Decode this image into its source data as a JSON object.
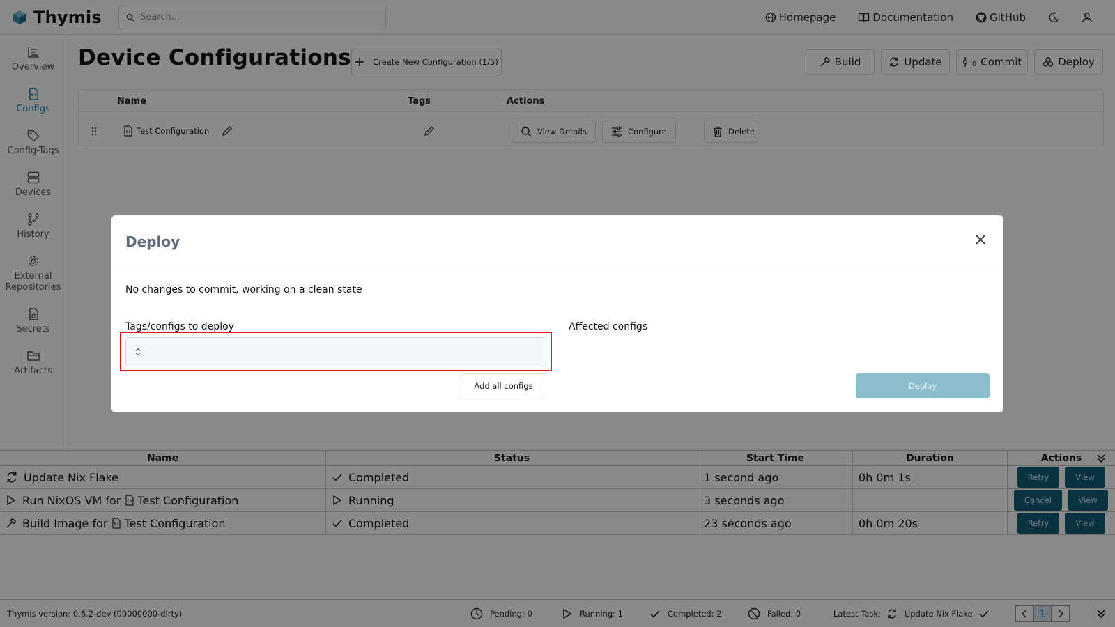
{
  "app": {
    "name": "Thymis"
  },
  "search": {
    "placeholder": "Search..."
  },
  "nav": {
    "homepage": "Homepage",
    "documentation": "Documentation",
    "github": "GitHub"
  },
  "sidebar": {
    "items": [
      {
        "label": "Overview",
        "icon": "chart-icon"
      },
      {
        "label": "Configs",
        "icon": "config-file-icon",
        "active": true
      },
      {
        "label": "Config-Tags",
        "icon": "tag-icon"
      },
      {
        "label": "Devices",
        "icon": "server-icon"
      },
      {
        "label": "History",
        "icon": "git-branch-icon"
      },
      {
        "label": "External Repositories",
        "icon": "gear-icon"
      },
      {
        "label": "Secrets",
        "icon": "lock-file-icon"
      },
      {
        "label": "Artifacts",
        "icon": "folder-icon"
      }
    ]
  },
  "page": {
    "title": "Device Configurations",
    "create_button": "Create New Configuration (1/5)",
    "build": "Build",
    "update": "Update",
    "commit": "Commit",
    "commit_count": "0",
    "deploy": "Deploy"
  },
  "config_table": {
    "headers": {
      "name": "Name",
      "tags": "Tags",
      "actions": "Actions"
    },
    "rows": [
      {
        "name": "Test Configuration",
        "view_details": "View Details",
        "configure": "Configure",
        "delete": "Delete"
      }
    ]
  },
  "tasks": {
    "headers": {
      "name": "Name",
      "status": "Status",
      "start_time": "Start Time",
      "duration": "Duration",
      "actions": "Actions"
    },
    "rows": [
      {
        "name": "Update Nix Flake",
        "config": "",
        "status": "Completed",
        "start_time": "1 second ago",
        "duration": "0h 0m 1s",
        "btn1": "Retry",
        "btn2": "View"
      },
      {
        "name": "Run NixOS VM for",
        "config": "Test Configuration",
        "status": "Running",
        "start_time": "3 seconds ago",
        "duration": "",
        "btn1": "Cancel",
        "btn2": "View"
      },
      {
        "name": "Build Image for",
        "config": "Test Configuration",
        "status": "Completed",
        "start_time": "23 seconds ago",
        "duration": "0h 0m 20s",
        "btn1": "Retry",
        "btn2": "View"
      }
    ]
  },
  "footer": {
    "version": "Thymis version: 0.6.2-dev (00000000-dirty)",
    "pending": "Pending: 0",
    "running": "Running: 1",
    "completed": "Completed: 2",
    "failed": "Failed: 0",
    "latest_task_label": "Latest Task:",
    "latest_task": "Update Nix Flake",
    "page": "1"
  },
  "modal": {
    "title": "Deploy",
    "message": "No changes to commit, working on a clean state",
    "tags_label": "Tags/configs to deploy",
    "affected_label": "Affected configs",
    "add_all": "Add all configs",
    "deploy_button": "Deploy"
  },
  "colors": {
    "accent": "#1f7ea1",
    "action_button": "#0f5d76",
    "deploy_disabled": "#8cbdcc",
    "highlight": "#e0161d"
  }
}
